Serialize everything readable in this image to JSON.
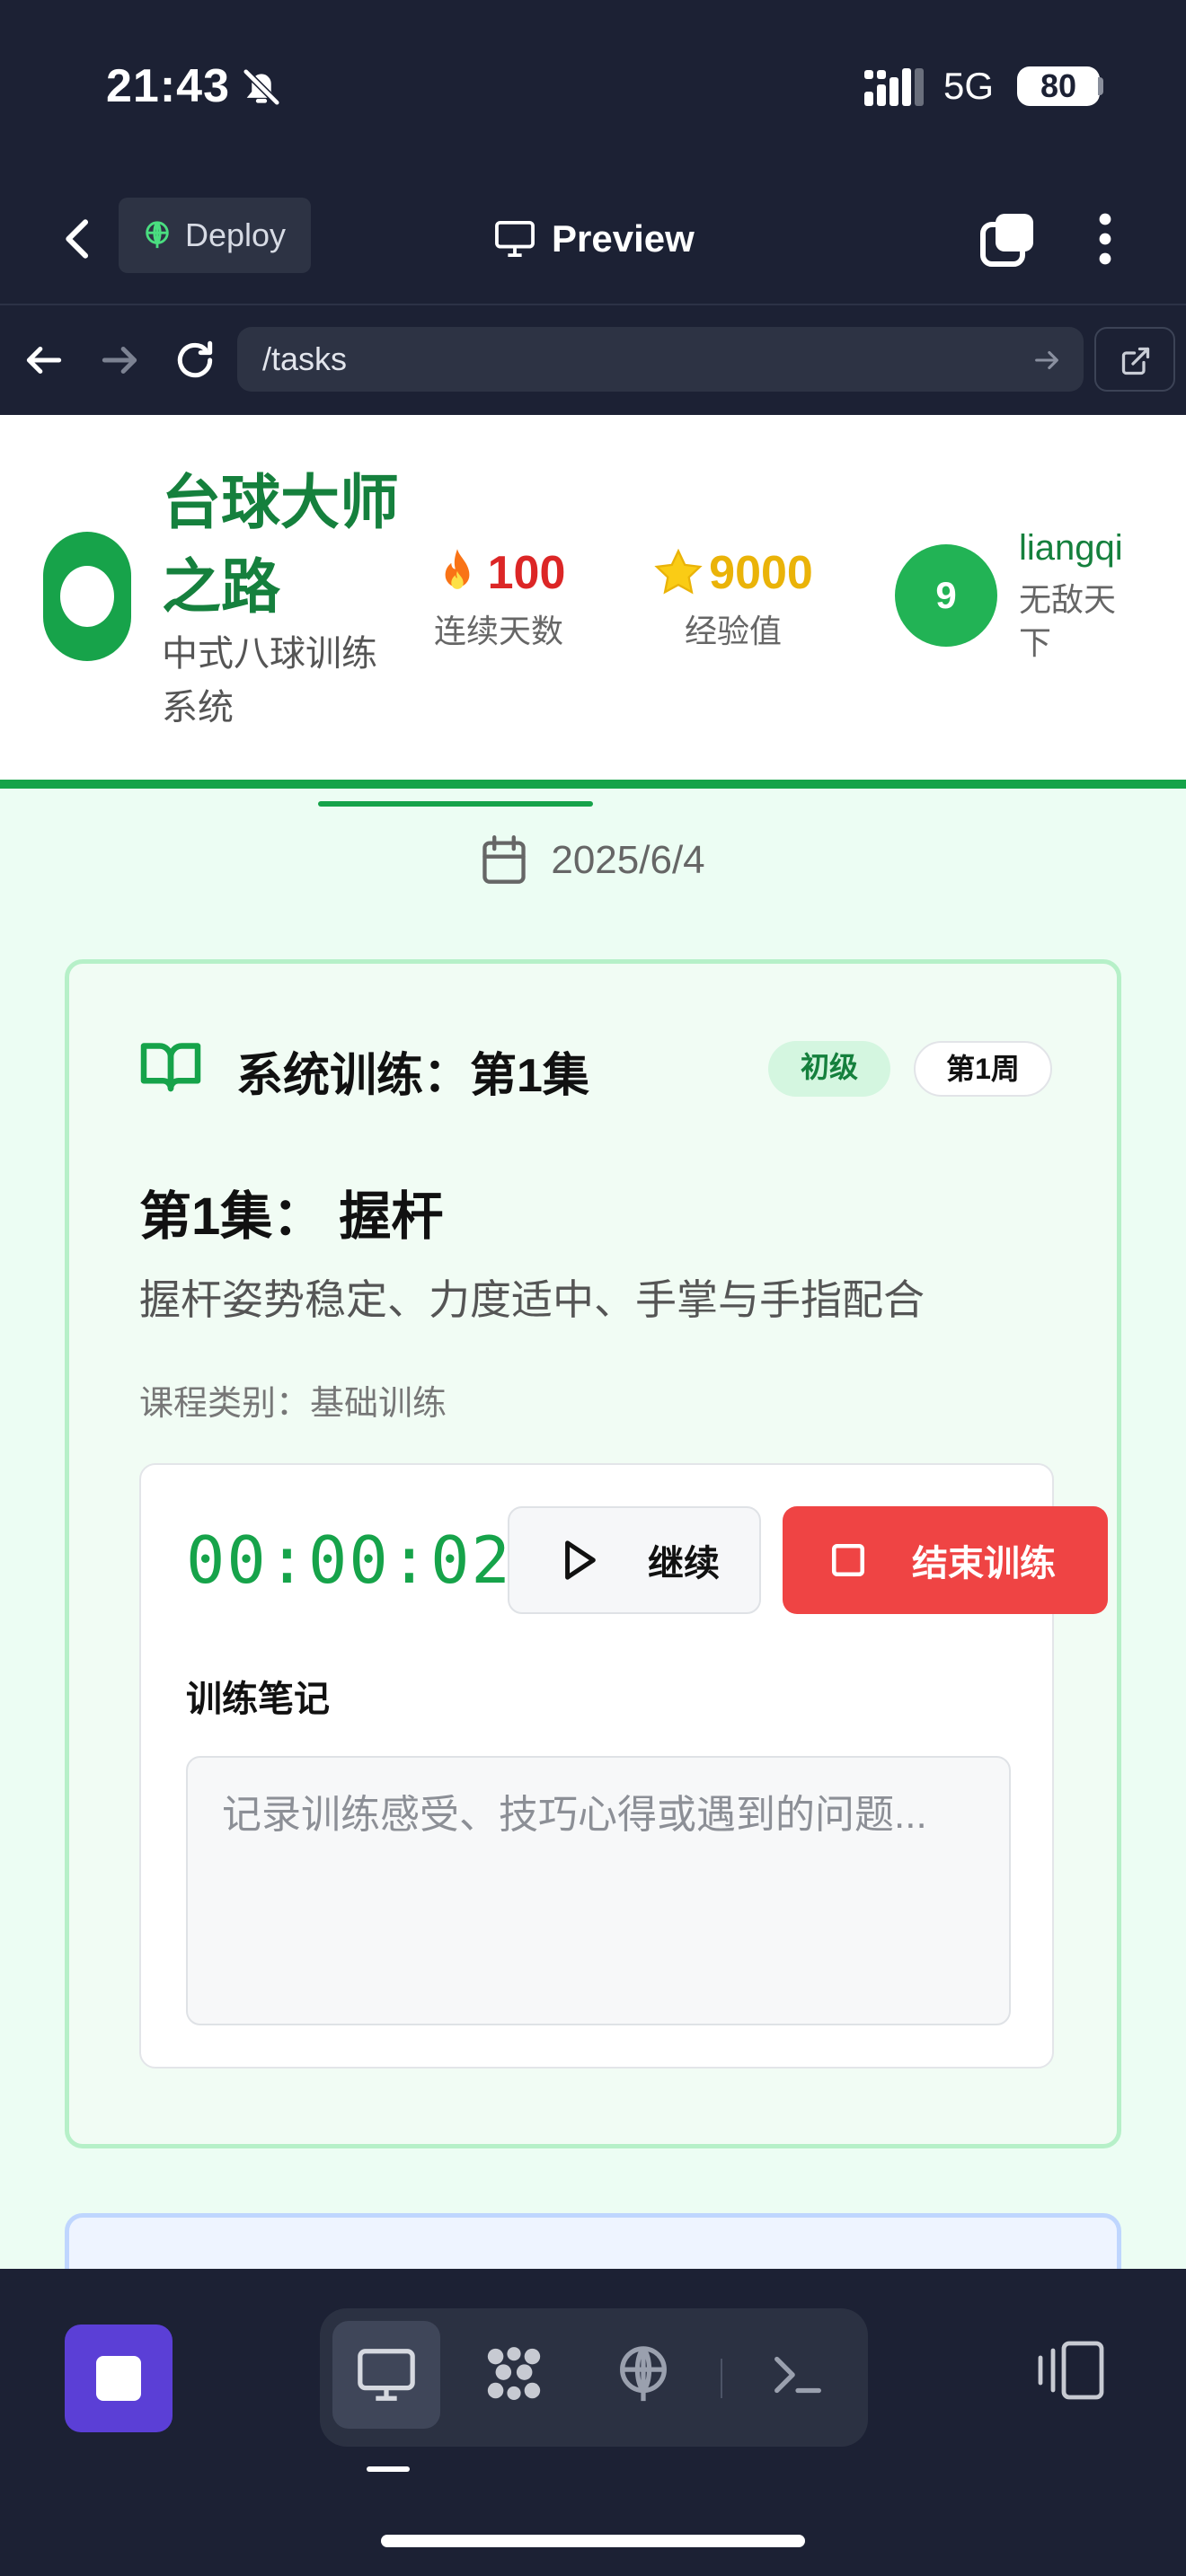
{
  "status_bar": {
    "time": "21:43",
    "network": "5G",
    "battery": "80"
  },
  "app_header": {
    "deploy_label": "Deploy",
    "preview_label": "Preview"
  },
  "address_bar": {
    "url": "/tasks"
  },
  "site": {
    "title": "台球大师之路",
    "subtitle": "中式八球训练系统",
    "streak": {
      "value": "100",
      "label": "连续天数"
    },
    "xp": {
      "value": "9000",
      "label": "经验值"
    },
    "user": {
      "level": "9",
      "name": "liangqi",
      "rank": "无敌天下"
    }
  },
  "colors": {
    "brand": "#16a34a",
    "danger": "#ef4444",
    "xp": "#eab308",
    "streak": "#dc2626"
  },
  "main": {
    "date": "2025/6/4",
    "lesson": {
      "heading": "系统训练：第1集",
      "level_badge": "初级",
      "week_badge": "第1周",
      "title": "第1集： 握杆",
      "description": "握杆姿势稳定、力度适中、手掌与手指配合",
      "category": "课程类别：基础训练",
      "timer": "00:00:02",
      "continue_label": "继续",
      "end_label": "结束训练",
      "notes_label": "训练笔记",
      "notes_placeholder": "记录训练感受、技巧心得或遇到的问题..."
    }
  },
  "icons": {
    "back": "chevron-left-icon",
    "deploy": "globe-icon",
    "preview": "monitor-icon",
    "tabs": "tabs-icon",
    "more": "more-vertical-icon",
    "book": "book-open-icon",
    "calendar": "calendar-icon",
    "play": "play-icon",
    "stop": "square-icon"
  }
}
